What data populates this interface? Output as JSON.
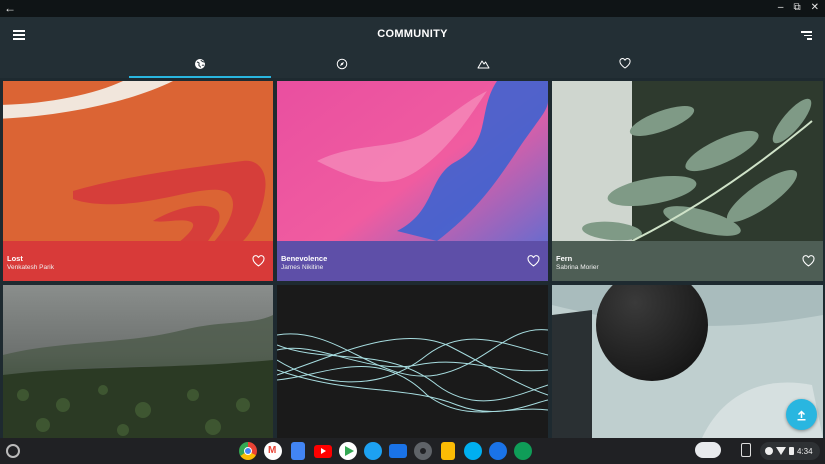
{
  "window": {
    "back_glyph": "←",
    "controls": [
      "–",
      "⧉",
      "✕"
    ]
  },
  "appbar": {
    "title": "COMMUNITY"
  },
  "tabs": [
    {
      "icon": "globe-icon",
      "active": true
    },
    {
      "icon": "compass-icon",
      "active": false
    },
    {
      "icon": "mountain-icon",
      "active": false
    },
    {
      "icon": "heart-icon",
      "active": false
    }
  ],
  "cards": [
    {
      "name": "Lost",
      "author": "Venkatesh Parik",
      "info_color": "#d83a39"
    },
    {
      "name": "Benevolence",
      "author": "James Nikitine",
      "info_color": "#5e4fa8"
    },
    {
      "name": "Fern",
      "author": "Sabrina Morier",
      "info_color": "#4e5e55"
    },
    {
      "name": "",
      "author": ""
    },
    {
      "name": "",
      "author": ""
    },
    {
      "name": "",
      "author": ""
    }
  ],
  "fab": {
    "icon": "download-icon"
  },
  "shelf": {
    "apps": [
      "chrome-icon",
      "gmail-icon",
      "docs-icon",
      "youtube-icon",
      "play-store-icon",
      "twitter-icon",
      "files-icon",
      "settings-icon",
      "keep-icon",
      "skype-icon",
      "duo-icon",
      "hangouts-icon"
    ],
    "time": "4:34"
  },
  "colors": {
    "accent": "#29b6e0",
    "appbar": "#232f35"
  }
}
